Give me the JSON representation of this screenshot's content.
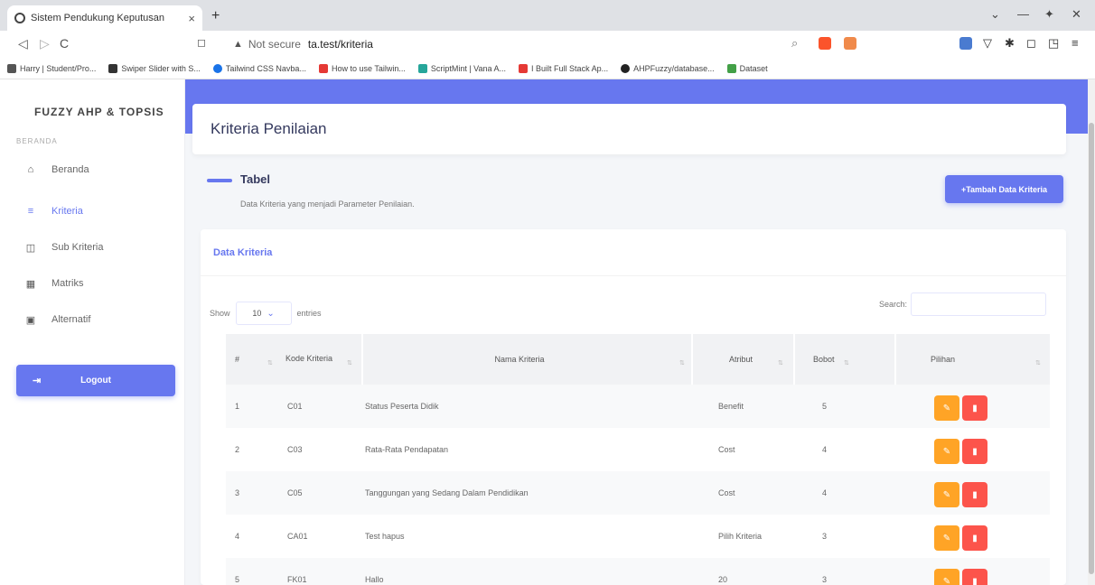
{
  "browser": {
    "tab_title": "Sistem Pendukung Keputusan",
    "tab_close": "×",
    "new_tab": "+",
    "security": "Not secure",
    "url": "ta.test/kriteria",
    "bookmarks": [
      {
        "label": "Harry | Student/Pro...",
        "color": "#555555"
      },
      {
        "label": "Swiper Slider with S...",
        "color": "#333333"
      },
      {
        "label": "Tailwind CSS Navba...",
        "color": "#1a73e8"
      },
      {
        "label": "How to use Tailwin...",
        "color": "#e53935"
      },
      {
        "label": "ScriptMint | Vana A...",
        "color": "#26a69a"
      },
      {
        "label": "I Built Full Stack Ap...",
        "color": "#e53935"
      },
      {
        "label": "AHPFuzzy/database...",
        "color": "#222222"
      },
      {
        "label": "Dataset",
        "color": "#43a047"
      }
    ]
  },
  "sidebar": {
    "brand": "FUZZY AHP & TOPSIS",
    "section": "BERANDA",
    "items": [
      {
        "label": "Beranda",
        "icon": "home-icon",
        "glyph": "⌂",
        "active": false
      },
      {
        "label": "Kriteria",
        "icon": "list-icon",
        "glyph": "≡",
        "active": true
      },
      {
        "label": "Sub Kriteria",
        "icon": "clipboard-icon",
        "glyph": "◫",
        "active": false
      },
      {
        "label": "Matriks",
        "icon": "table-icon",
        "glyph": "▦",
        "active": false
      },
      {
        "label": "Alternatif",
        "icon": "square-icon",
        "glyph": "▣",
        "active": false
      }
    ],
    "logout": "Logout"
  },
  "main": {
    "title": "Kriteria Penilaian",
    "section_title": "Tabel",
    "section_desc": "Data Kriteria yang menjadi Parameter Penilaian.",
    "add_button": "+Tambah Data Kriteria",
    "card_title": "Data Kriteria",
    "show_label": "Show",
    "entries_value": "10",
    "entries_label": "entries",
    "search_label": "Search:"
  },
  "table": {
    "headers": {
      "no": "#",
      "code": "Kode Kriteria",
      "name": "Nama Kriteria",
      "attr": "Atribut",
      "weight": "Bobot",
      "action": "Pilihan"
    },
    "rows": [
      {
        "no": "1",
        "code": "C01",
        "name": "Status Peserta Didik",
        "attr": "Benefit",
        "weight": "5"
      },
      {
        "no": "2",
        "code": "C03",
        "name": "Rata-Rata Pendapatan",
        "attr": "Cost",
        "weight": "4"
      },
      {
        "no": "3",
        "code": "C05",
        "name": "Tanggungan yang Sedang Dalam Pendidikan",
        "attr": "Cost",
        "weight": "4"
      },
      {
        "no": "4",
        "code": "CA01",
        "name": "Test hapus",
        "attr": "Pilih Kriteria",
        "weight": "3"
      },
      {
        "no": "5",
        "code": "FK01",
        "name": "Hallo",
        "attr": "20",
        "weight": "3"
      }
    ]
  },
  "colors": {
    "primary": "#6777ef",
    "warning": "#ffa426",
    "danger": "#fc544b"
  }
}
